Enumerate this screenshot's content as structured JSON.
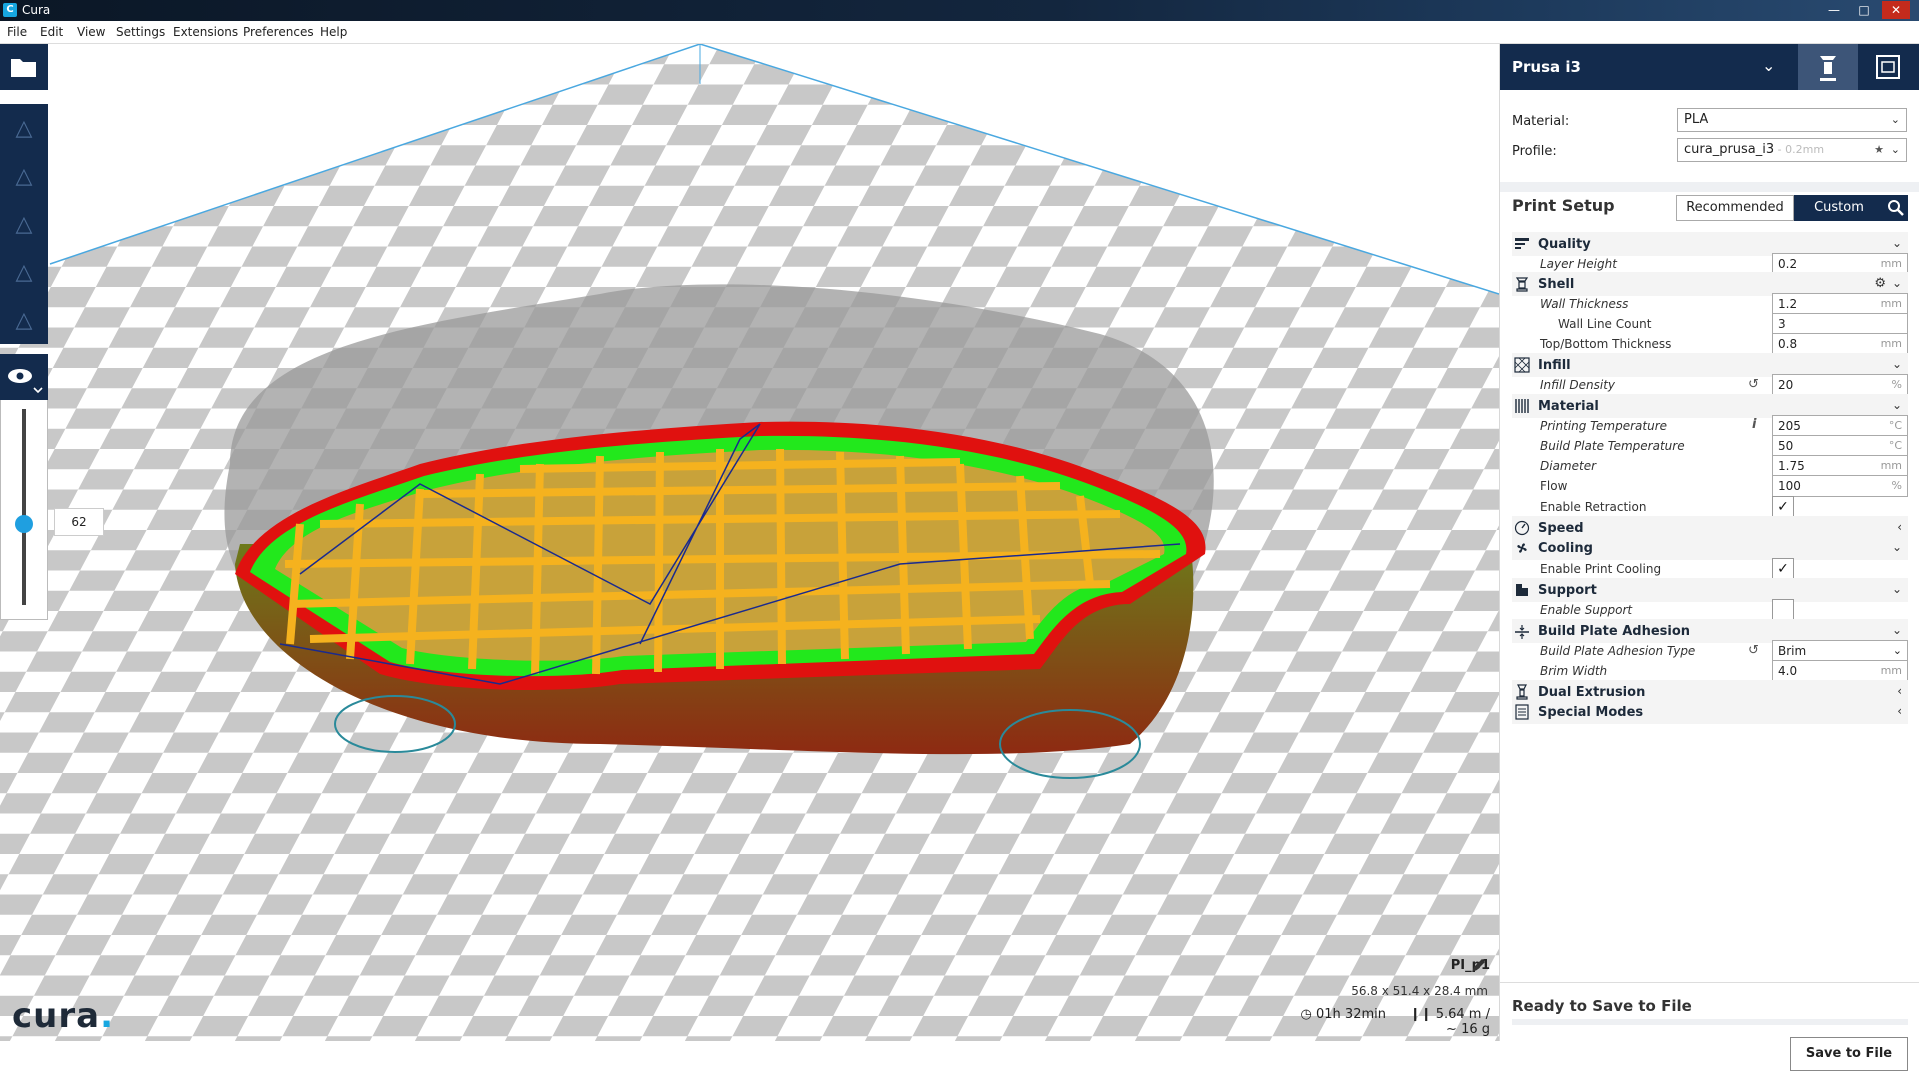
{
  "window": {
    "title": "Cura",
    "app_icon": "C"
  },
  "menu": [
    "File",
    "Edit",
    "View",
    "Settings",
    "Extensions",
    "Preferences",
    "Help"
  ],
  "layer": {
    "value": "62"
  },
  "job": {
    "name": "PI_p1",
    "dimensions": "56.8 x 51.4 x 28.4 mm",
    "time": "01h 32min",
    "material": "5.64 m / ~ 16 g"
  },
  "logo": {
    "text": "cura",
    "dot": "."
  },
  "machine": {
    "name": "Prusa i3",
    "chevron": "⌄"
  },
  "material": {
    "label": "Material:",
    "value": "PLA"
  },
  "profile": {
    "label": "Profile:",
    "value": "cura_prusa_i3",
    "suffix": " - 0.2mm"
  },
  "print_setup": {
    "label": "Print Setup",
    "recommended": "Recommended",
    "custom": "Custom"
  },
  "categories": {
    "quality": "Quality",
    "shell": "Shell",
    "infill": "Infill",
    "material": "Material",
    "speed": "Speed",
    "cooling": "Cooling",
    "support": "Support",
    "adhesion": "Build Plate Adhesion",
    "dual": "Dual Extrusion",
    "special": "Special Modes"
  },
  "settings": {
    "layer_height": {
      "label": "Layer Height",
      "value": "0.2",
      "unit": "mm"
    },
    "wall_thickness": {
      "label": "Wall Thickness",
      "value": "1.2",
      "unit": "mm"
    },
    "wall_line_count": {
      "label": "Wall Line Count",
      "value": "3"
    },
    "top_bottom": {
      "label": "Top/Bottom Thickness",
      "value": "0.8",
      "unit": "mm"
    },
    "infill_density": {
      "label": "Infill Density",
      "value": "20",
      "unit": "%"
    },
    "print_temp": {
      "label": "Printing Temperature",
      "value": "205",
      "unit": "°C",
      "info": "i"
    },
    "bed_temp": {
      "label": "Build Plate Temperature",
      "value": "50",
      "unit": "°C"
    },
    "diameter": {
      "label": "Diameter",
      "value": "1.75",
      "unit": "mm"
    },
    "flow": {
      "label": "Flow",
      "value": "100",
      "unit": "%"
    },
    "retraction": {
      "label": "Enable Retraction",
      "checked": "✓"
    },
    "print_cooling": {
      "label": "Enable Print Cooling",
      "checked": "✓"
    },
    "enable_support": {
      "label": "Enable Support",
      "checked": ""
    },
    "adhesion_type": {
      "label": "Build Plate Adhesion Type",
      "value": "Brim"
    },
    "brim_width": {
      "label": "Brim Width",
      "value": "4.0",
      "unit": "mm"
    }
  },
  "output": {
    "status": "Ready to Save to File",
    "button": "Save to File"
  },
  "icons": {
    "reset": "↺",
    "gear": "⚙",
    "down": "⌄",
    "left": "‹",
    "check": "✓",
    "star": "★"
  }
}
